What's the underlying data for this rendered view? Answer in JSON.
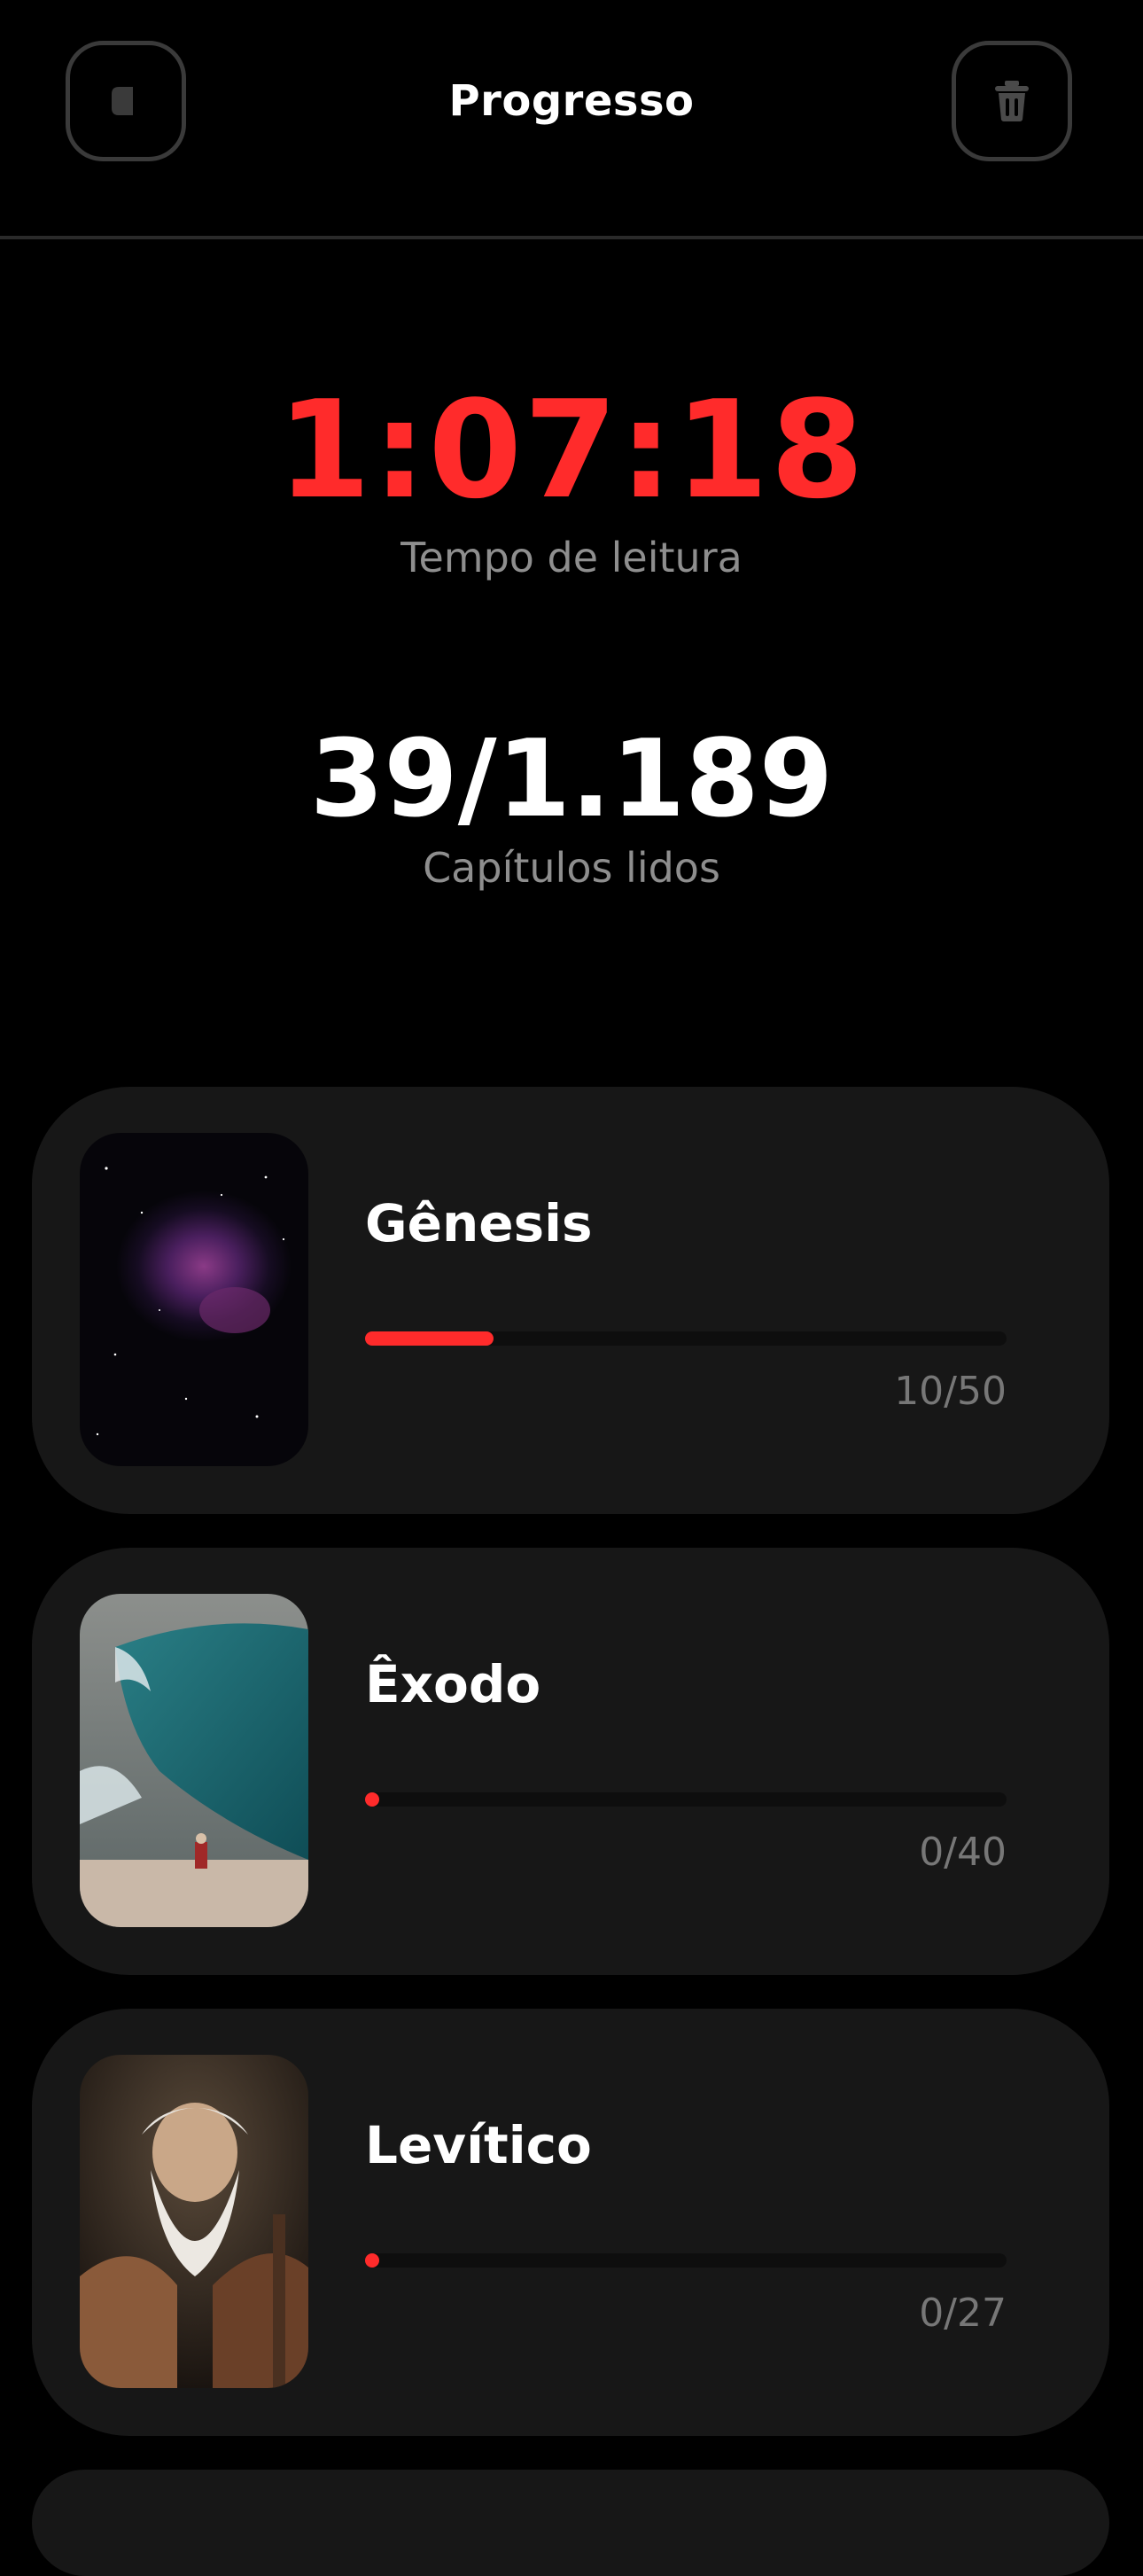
{
  "header": {
    "title": "Progresso",
    "back_icon": "back-arrow-icon",
    "delete_icon": "trash-icon"
  },
  "stats": {
    "reading_time": "1:07:18",
    "reading_time_label": "Tempo de leitura",
    "chapters_read": "39/1.189",
    "chapters_read_label": "Capítulos lidos"
  },
  "colors": {
    "accent": "#ff2b2b",
    "card_bg": "#171717",
    "background": "#000000",
    "muted_text": "#8e8e8e"
  },
  "books": [
    {
      "name": "Gênesis",
      "progress_text": "10/50",
      "progress_fraction": 0.2,
      "image": "nebula-space-image"
    },
    {
      "name": "Êxodo",
      "progress_text": "0/40",
      "progress_fraction": 0.0,
      "image": "parting-sea-image"
    },
    {
      "name": "Levítico",
      "progress_text": "0/27",
      "progress_fraction": 0.0,
      "image": "old-bearded-man-image"
    }
  ]
}
